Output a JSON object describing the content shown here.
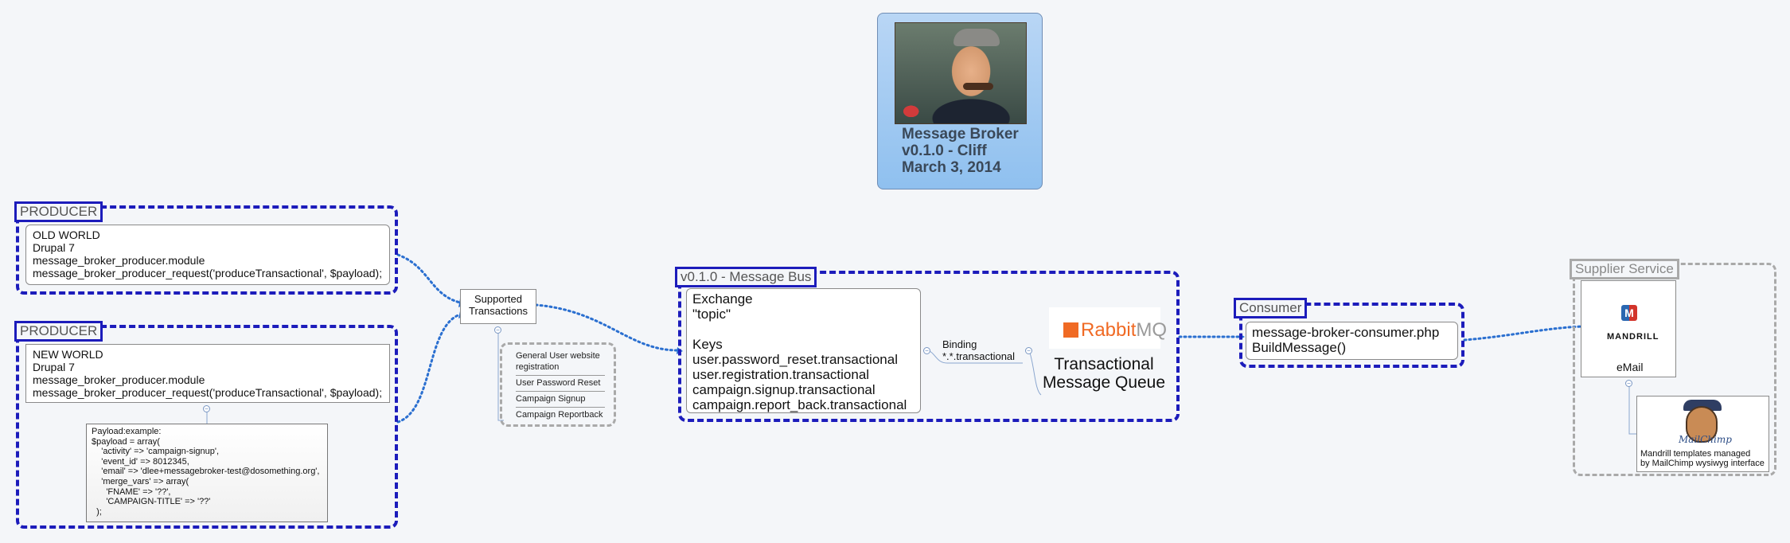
{
  "central": {
    "lines": [
      "Message Broker",
      "v0.1.0 - Cliff",
      "March 3, 2014"
    ]
  },
  "producer_old": {
    "tag": "PRODUCER",
    "lines": [
      "OLD WORLD",
      "Drupal 7",
      "message_broker_producer.module",
      "message_broker_producer_request('produceTransactional', $payload);"
    ]
  },
  "producer_new": {
    "tag": "PRODUCER",
    "lines": [
      "NEW WORLD",
      "Drupal 7",
      "message_broker_producer.module",
      "message_broker_producer_request('produceTransactional', $payload);"
    ],
    "payload": [
      "Payload:example:",
      "",
      "$payload = array(",
      "    'activity' => 'campaign-signup',",
      "    'event_id' => 8012345,",
      "    'email' => 'dlee+messagebroker-test@dosomething.org',",
      "    'merge_vars' => array(",
      "      'FNAME' => '??',",
      "      'CAMPAIGN-TITLE' => '??'",
      "  );"
    ]
  },
  "supported": {
    "lines": [
      "Supported",
      "Transactions"
    ],
    "items": [
      "General User website registration",
      "User Password Reset",
      "Campaign Signup",
      "Campaign Reportback"
    ]
  },
  "message_bus": {
    "tag": "v0.1.0 - Message Bus",
    "exchange_lines": [
      "Exchange",
      "\"topic\"",
      "",
      "Keys",
      "user.password_reset.transactional",
      "user.registration.transactional",
      "campaign.signup.transactional",
      "campaign.report_back.transactional"
    ],
    "binding_lines": [
      "Binding",
      "*.*.transactional"
    ],
    "rabbit_word": "Rabbit",
    "rabbit_mq": "MQ",
    "queue_lines": [
      "Transactional",
      "Message Queue"
    ]
  },
  "consumer": {
    "tag": "Consumer",
    "lines": [
      "message-broker-consumer.php",
      "BuildMessage()"
    ]
  },
  "supplier": {
    "tag": "Supplier Service",
    "mandrill_logo_letter": "M",
    "mandrill_word": "MANDRILL",
    "email_label": "eMail",
    "mailchimp_word": "MailChimp",
    "note_lines": [
      "Mandrill templates managed",
      "by MailChimp wysiwyg interface"
    ]
  },
  "colors": {
    "group_border": "#1c1cbb",
    "supplier_border": "#a9a9a9",
    "connector": "#2a6fd0",
    "central_fill": "#a6ccf2"
  }
}
